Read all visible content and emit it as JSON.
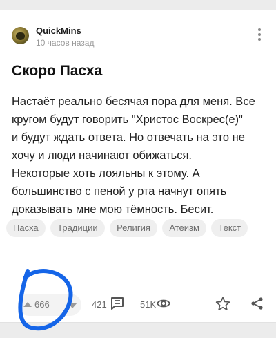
{
  "post": {
    "author": "QuickMins",
    "time": "10 часов назад",
    "title": "Скоро Пасха",
    "text": "Настаёт реально бесячая пора для меня. Все\nкругом будут говорить \"Христос Воскрес(е)\"\nи будут ждать ответа. Но отвечать на это не\nхочу и люди начинают обижаться.\nНекоторые хоть лояльны к этому. А\nбольшинство с пеной у рта начнут опять\nдоказывать мне мою тёмность. Бесит.",
    "tags": [
      "Пасха",
      "Традиции",
      "Религия",
      "Атеизм",
      "Текст"
    ]
  },
  "stats": {
    "rating": "666",
    "comments": "421",
    "views": "51K"
  },
  "icons": {
    "more": "more-vertical-icon",
    "upvote": "arrow-up-icon",
    "downvote": "arrow-down-icon",
    "comments": "comments-icon",
    "views": "eye-icon",
    "save": "star-icon",
    "share": "share-icon"
  },
  "colors": {
    "annotation_circle": "#1565e8",
    "tag_background": "#efefef",
    "vote_pill": "#f3f3f3"
  }
}
